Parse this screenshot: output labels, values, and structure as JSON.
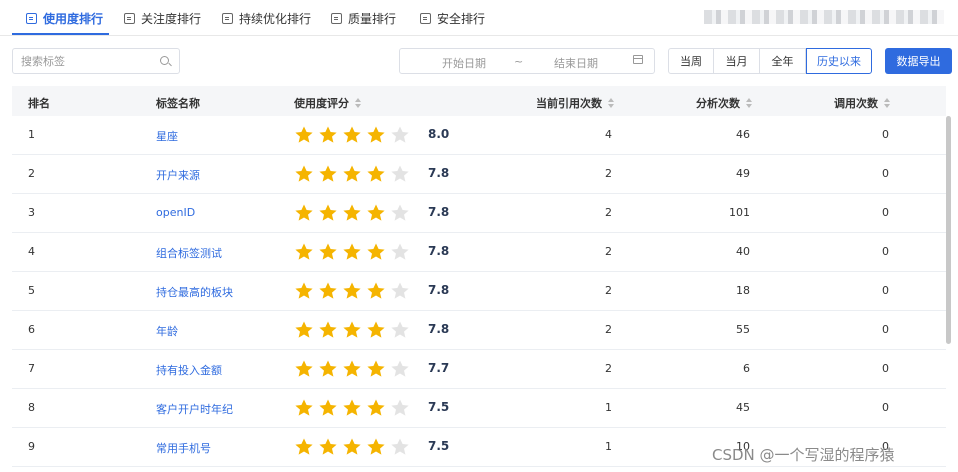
{
  "tabs": [
    {
      "label": "使用度排行",
      "active": true
    },
    {
      "label": "关注度排行"
    },
    {
      "label": "持续优化排行"
    },
    {
      "label": "质量排行"
    },
    {
      "label": "安全排行"
    }
  ],
  "search": {
    "placeholder": "搜索标签"
  },
  "date_range": {
    "start_placeholder": "开始日期",
    "separator": "~",
    "end_placeholder": "结束日期"
  },
  "period_buttons": [
    "当周",
    "当月",
    "全年",
    "历史以来"
  ],
  "export_label": "数据导出",
  "columns": [
    "排名",
    "标签名称",
    "使用度评分",
    "当前引用次数",
    "分析次数",
    "调用次数"
  ],
  "rows": [
    {
      "rank": "1",
      "name": "星座",
      "stars": 4,
      "score": "8.0",
      "refs": "4",
      "analysis": "46",
      "calls": "0"
    },
    {
      "rank": "2",
      "name": "开户来源",
      "stars": 4,
      "score": "7.8",
      "refs": "2",
      "analysis": "49",
      "calls": "0"
    },
    {
      "rank": "3",
      "name": "openID",
      "stars": 4,
      "score": "7.8",
      "refs": "2",
      "analysis": "101",
      "calls": "0"
    },
    {
      "rank": "4",
      "name": "组合标签测试",
      "stars": 4,
      "score": "7.8",
      "refs": "2",
      "analysis": "40",
      "calls": "0"
    },
    {
      "rank": "5",
      "name": "持仓最高的板块",
      "stars": 4,
      "score": "7.8",
      "refs": "2",
      "analysis": "18",
      "calls": "0"
    },
    {
      "rank": "6",
      "name": "年龄",
      "stars": 4,
      "score": "7.8",
      "refs": "2",
      "analysis": "55",
      "calls": "0"
    },
    {
      "rank": "7",
      "name": "持有投入金额",
      "stars": 4,
      "score": "7.7",
      "refs": "2",
      "analysis": "6",
      "calls": "0"
    },
    {
      "rank": "8",
      "name": "客户开户时年纪",
      "stars": 4,
      "score": "7.5",
      "refs": "1",
      "analysis": "45",
      "calls": "0"
    },
    {
      "rank": "9",
      "name": "常用手机号",
      "stars": 4,
      "score": "7.5",
      "refs": "1",
      "analysis": "10",
      "calls": "0"
    }
  ],
  "watermark": "CSDN @一个写湿的程序猿",
  "colors": {
    "accent": "#2f6bdf",
    "star_on": "#f5b400",
    "star_off": "#e3e3e3"
  }
}
